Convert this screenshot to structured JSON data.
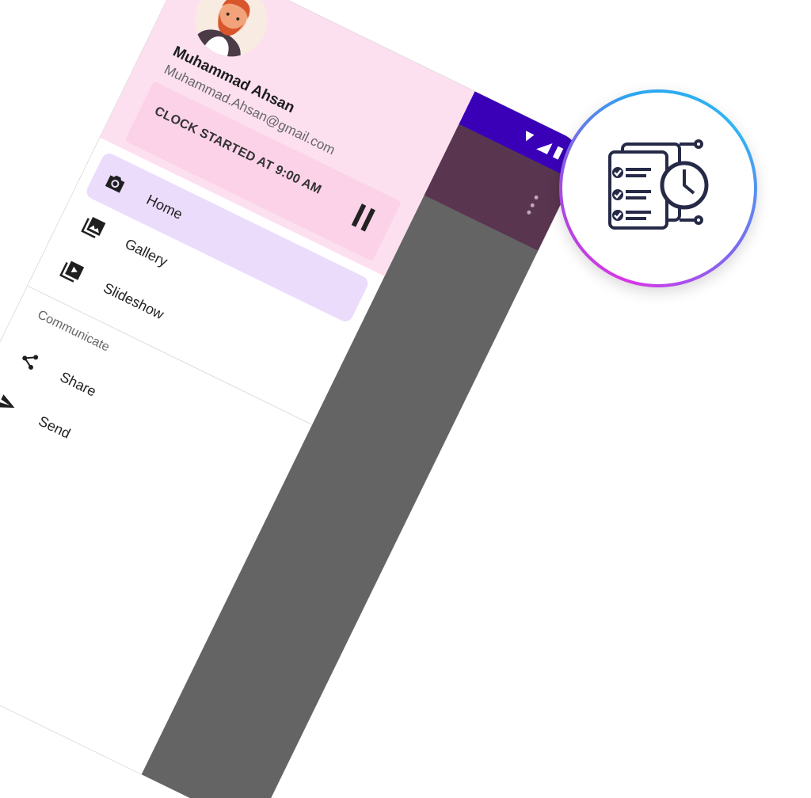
{
  "drawer": {
    "user_name": "Muhammad Ahsan",
    "user_email": "Muhammad.Ahsan@gmail.com",
    "clock_status": "CLOCK STARTED AT 9:00 AM",
    "menu_items": [
      {
        "label": "Home",
        "icon": "camera-icon",
        "active": true
      },
      {
        "label": "Gallery",
        "icon": "gallery-icon",
        "active": false
      },
      {
        "label": "Slideshow",
        "icon": "slideshow-icon",
        "active": false
      }
    ],
    "section_title": "Communicate",
    "communicate_items": [
      {
        "label": "Share",
        "icon": "share-icon"
      },
      {
        "label": "Send",
        "icon": "send-icon"
      }
    ]
  },
  "colors": {
    "status_bar": "#3a00b8",
    "toolbar": "#5a3550",
    "header_bg": "#fde0f0",
    "clock_card": "#fcd2e8",
    "active_item": "#ebdcfc"
  },
  "logo": {
    "icon": "checklist-clock-icon"
  }
}
